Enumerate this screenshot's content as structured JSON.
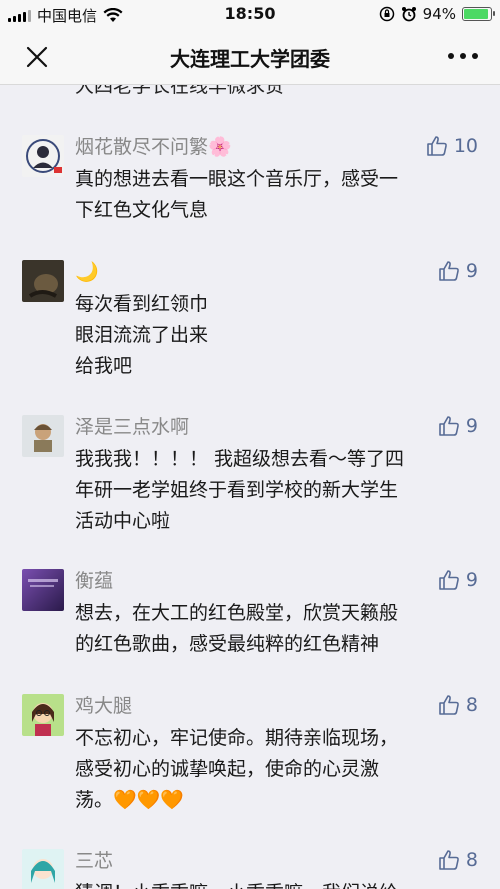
{
  "status_bar": {
    "carrier": "中国电信",
    "time": "18:50",
    "battery": "94%",
    "battery_level": 0.94
  },
  "nav": {
    "title": "大连理工大学团委"
  },
  "cut_off_text": "大四老学长在线羊微求贵",
  "comments": [
    {
      "nickname": "烟花散尽不问繁🌸",
      "likes": "10",
      "lines": [
        "真的想进去看一眼这个音乐厅，感受一",
        "下红色文化气息"
      ]
    },
    {
      "nickname": "🌙",
      "likes": "9",
      "lines": [
        "每次看到红领巾",
        "眼泪流流了出来",
        "给我吧"
      ]
    },
    {
      "nickname": "泽是三点水啊",
      "likes": "9",
      "lines": [
        "我我我！！！！ 我超级想去看～等了四",
        "年研一老学姐终于看到学校的新大学生",
        "活动中心啦"
      ]
    },
    {
      "nickname": "衡蕴",
      "likes": "9",
      "lines": [
        "想去，在大工的红色殿堂，欣赏天籁般",
        "的红色歌曲，感受最纯粹的红色精神"
      ]
    },
    {
      "nickname": "鸡大腿",
      "likes": "8",
      "lines": [
        "不忘初心，牢记使命。期待亲临现场，",
        "感受初心的诚挚唤起，使命的心灵激",
        "荡。🧡🧡🧡"
      ]
    },
    {
      "nickname": "三芯",
      "likes": "8",
      "lines": [
        "猜调！小乖乖嘛，小乖乖嘛，我们说给"
      ]
    }
  ]
}
